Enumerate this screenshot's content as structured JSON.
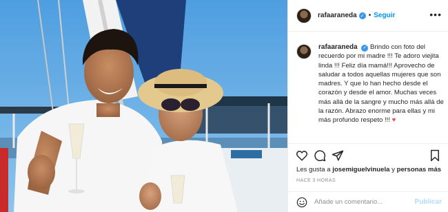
{
  "header": {
    "username": "rafaaraneda",
    "verified_symbol": "✓",
    "separator": "•",
    "follow_label": "Seguir",
    "more_symbol": "•••"
  },
  "caption": {
    "username": "rafaaraneda",
    "verified_symbol": "✓",
    "text": "Brindo con foto del recuerdo por mi madre !!! Te adoro viejita linda !!! Feliz día mamá!!! Aprovecho de saludar a todos aquellas mujeres que son madres. Y que lo han hecho desde el corazón y desde el amor. Muchas veces más allá de la sangre y mucho más allá de la razón. Abrazo enorme para ellas y mi más profundo respeto !!!",
    "heart": "♥"
  },
  "likes": {
    "prefix": "Les gusta a",
    "user": "josemiguelvinuela",
    "connector": "y",
    "others": "personas más"
  },
  "timestamp": "HACE 3 HORAS",
  "comment": {
    "placeholder": "Añade un comentario...",
    "publish_label": "Publicar"
  },
  "icons": {
    "like": "heart-icon",
    "comment": "comment-icon",
    "share": "share-icon",
    "save": "bookmark-icon",
    "emoji": "emoji-icon"
  },
  "colors": {
    "accent": "#0095f6",
    "verified": "#3897f0",
    "heart": "#ed4956",
    "publish_disabled": "#b3dbff",
    "muted": "#8e8e8e",
    "sky": "#6fb0e3"
  }
}
